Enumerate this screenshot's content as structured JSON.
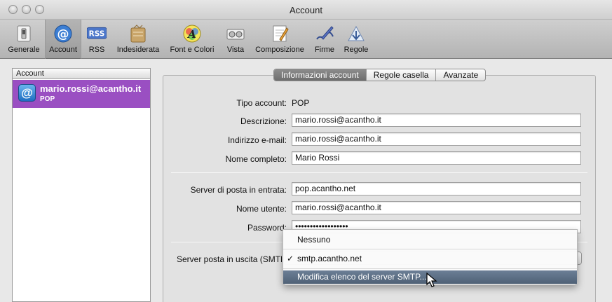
{
  "window": {
    "title": "Account"
  },
  "toolbar": {
    "items": [
      {
        "label": "Generale",
        "icon": "switch-icon"
      },
      {
        "label": "Account",
        "icon": "at-sign-icon",
        "selected": true
      },
      {
        "label": "RSS",
        "icon": "rss-icon"
      },
      {
        "label": "Indesiderata",
        "icon": "junk-mail-icon"
      },
      {
        "label": "Font e Colori",
        "icon": "font-colors-icon"
      },
      {
        "label": "Vista",
        "icon": "viewing-icon"
      },
      {
        "label": "Composizione",
        "icon": "composing-icon"
      },
      {
        "label": "Firme",
        "icon": "signatures-icon"
      },
      {
        "label": "Regole",
        "icon": "rules-icon"
      }
    ]
  },
  "accounts": {
    "header": "Account",
    "items": [
      {
        "name": "mario.rossi@acantho.it",
        "type": "POP"
      }
    ]
  },
  "tabs": [
    {
      "label": "Informazioni account",
      "active": true
    },
    {
      "label": "Regole casella",
      "active": false
    },
    {
      "label": "Avanzate",
      "active": false
    }
  ],
  "form": {
    "account_type_label": "Tipo account:",
    "account_type_value": "POP",
    "description_label": "Descrizione:",
    "description_value": "mario.rossi@acantho.it",
    "email_label": "Indirizzo e-mail:",
    "email_value": "mario.rossi@acantho.it",
    "fullname_label": "Nome completo:",
    "fullname_value": "Mario Rossi",
    "incoming_label": "Server di posta in entrata:",
    "incoming_value": "pop.acantho.net",
    "username_label": "Nome utente:",
    "username_value": "mario.rossi@acantho.it",
    "password_label": "Password:",
    "password_value": "••••••••••••••••••",
    "smtp_label": "Server posta in uscita (SMTP):"
  },
  "smtp_menu": {
    "items": [
      {
        "label": "Nessuno",
        "checked": false
      },
      {
        "label": "smtp.acantho.net",
        "checked": true
      },
      {
        "label": "Modifica elenco del server SMTP...",
        "highlighted": true
      }
    ],
    "check_mark": "✓"
  }
}
